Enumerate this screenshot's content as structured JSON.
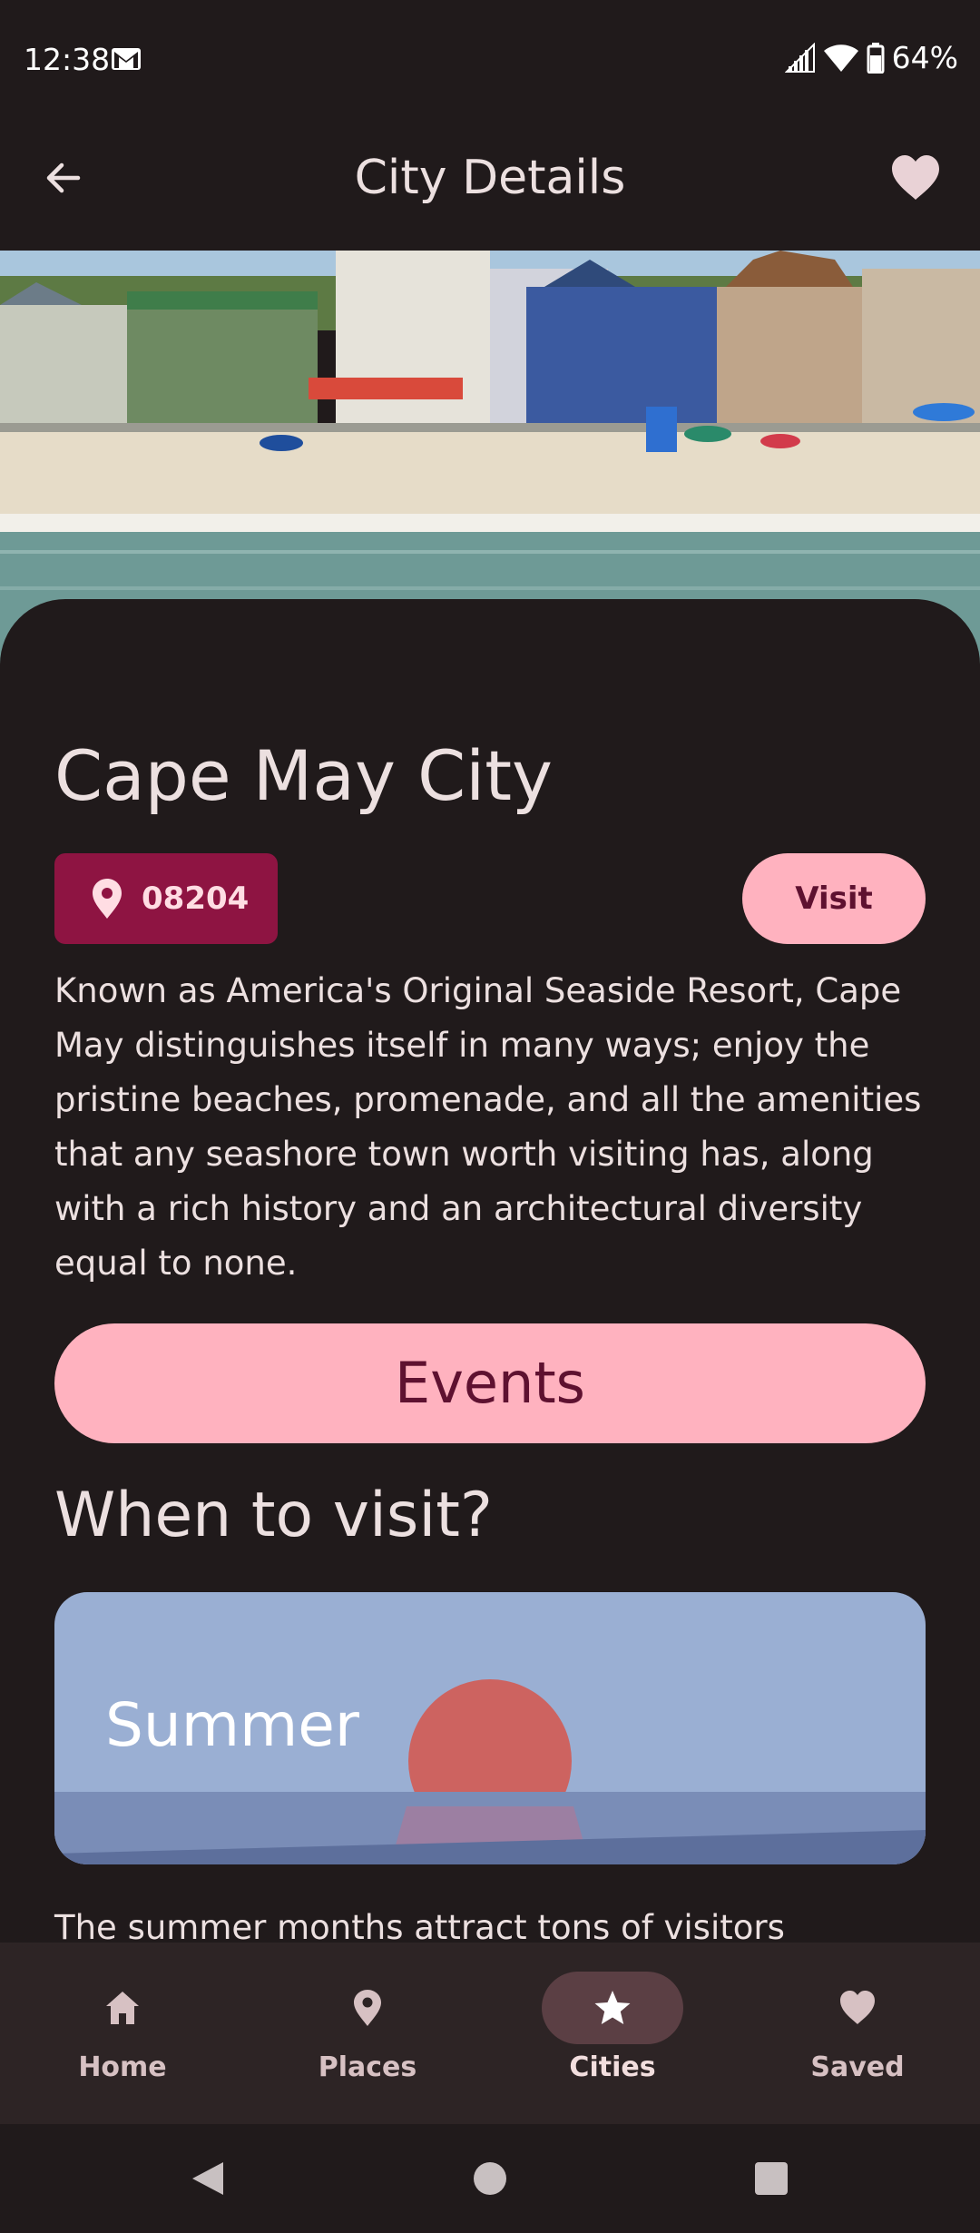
{
  "status_bar": {
    "time": "12:38",
    "battery": "64%"
  },
  "top_bar": {
    "title": "City Details",
    "back_icon": "arrow-left-icon",
    "favorite_icon": "heart-icon"
  },
  "city": {
    "name": "Cape May City",
    "zip": "08204",
    "visit_label": "Visit",
    "description": "Known as America's Original Seaside Resort, Cape May distinguishes itself in many ways; enjoy the pristine beaches, promenade, and all the amenities that any seashore town worth visiting has, along with a rich history and an architectural diversity equal to none.",
    "events_label": "Events"
  },
  "when_to_visit": {
    "title": "When to visit?",
    "season": "Summer",
    "text": "The summer months attract tons of visitors"
  },
  "bottom_nav": {
    "items": [
      {
        "label": "Home",
        "icon": "home-icon",
        "active": false
      },
      {
        "label": "Places",
        "icon": "place-pin-icon",
        "active": false
      },
      {
        "label": "Cities",
        "icon": "star-icon",
        "active": true
      },
      {
        "label": "Saved",
        "icon": "heart-icon",
        "active": false
      }
    ]
  },
  "colors": {
    "background": "#201a1b",
    "accent_pink": "#ffb2bf",
    "chip_red": "#8e1442",
    "on_accent": "#5e1130",
    "nav_background": "#2d2425",
    "nav_active_pill": "#5b3f44"
  }
}
